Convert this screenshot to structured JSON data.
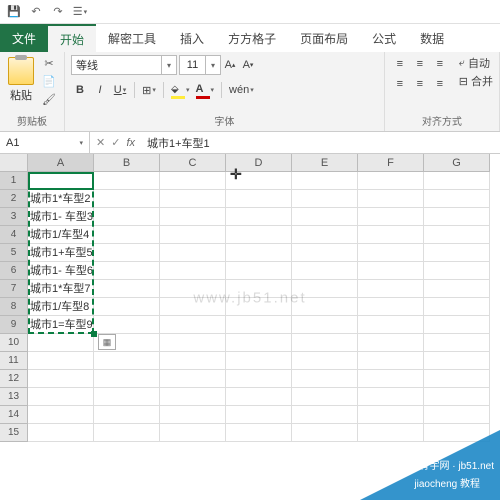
{
  "qat": {
    "save": "💾",
    "undo": "↶",
    "redo": "↷",
    "more": "▾"
  },
  "tabs": {
    "file": "文件",
    "home": "开始",
    "decrypt": "解密工具",
    "insert": "插入",
    "ffgz": "方方格子",
    "layout": "页面布局",
    "formula": "公式",
    "data": "数据"
  },
  "ribbon": {
    "clipboard": {
      "label": "剪贴板",
      "paste": "粘贴"
    },
    "font": {
      "label": "字体",
      "name": "等线",
      "size": "11",
      "bold": "B",
      "italic": "I",
      "underline": "U",
      "wen": "wén"
    },
    "align": {
      "label": "对齐方式",
      "wrap": "自动",
      "merge": "合并"
    }
  },
  "namebox": {
    "ref": "A1"
  },
  "formula_bar": {
    "value": "城市1+车型1"
  },
  "columns": [
    "A",
    "B",
    "C",
    "D",
    "E",
    "F",
    "G"
  ],
  "rows_shown": 15,
  "cells": {
    "A1": "城市1+车型1",
    "A2": "城市1*车型2",
    "A3": "城市1- 车型3",
    "A4": "城市1/车型4",
    "A5": "城市1+车型5",
    "A6": "城市1- 车型6",
    "A7": "城市1*车型7",
    "A8": "城市1/车型8",
    "A9": "城市1=车型9"
  },
  "watermark": {
    "line1": "脊宇网 · jb51.net",
    "line2": "jiaocheng 教程"
  },
  "center_wm": "www.jb51.net"
}
